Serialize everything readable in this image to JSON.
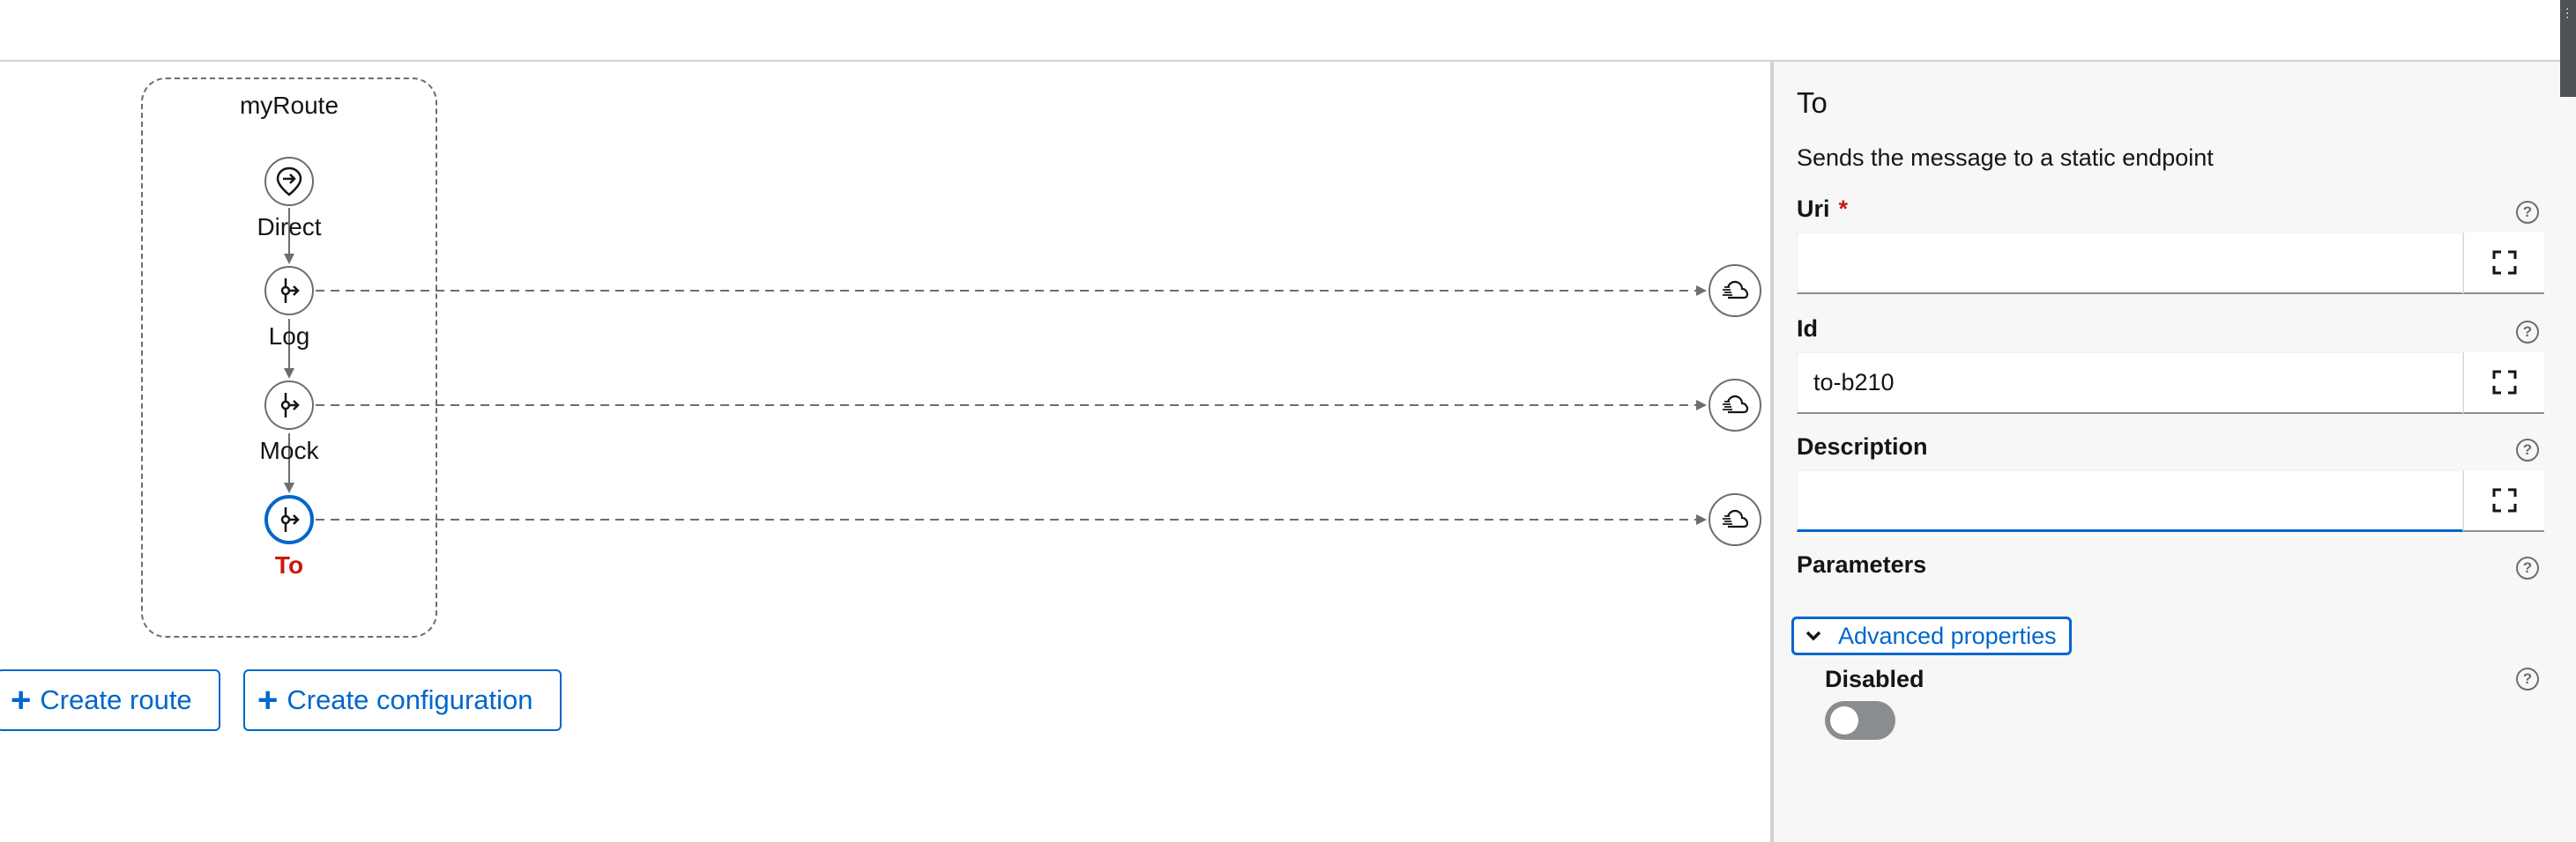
{
  "route": {
    "title": "myRoute",
    "nodes": [
      {
        "label": "Direct",
        "icon": "direct-pin-icon"
      },
      {
        "label": "Log",
        "icon": "log-processor-icon"
      },
      {
        "label": "Mock",
        "icon": "mock-processor-icon"
      },
      {
        "label": "To",
        "icon": "to-processor-icon",
        "selected": true
      }
    ],
    "endpoint_icon": "cloud-endpoint-icon"
  },
  "actions": {
    "create_route": "Create route",
    "create_configuration": "Create configuration"
  },
  "panel": {
    "title": "To",
    "description": "Sends the message to a static endpoint",
    "fields": {
      "uri": {
        "label": "Uri",
        "required_mark": "*",
        "value": ""
      },
      "id": {
        "label": "Id",
        "value": "to-b210"
      },
      "description": {
        "label": "Description",
        "value": ""
      }
    },
    "parameters_label": "Parameters",
    "advanced_label": "Advanced properties",
    "disabled": {
      "label": "Disabled",
      "value": false
    }
  },
  "colors": {
    "accent": "#0066cc",
    "required": "#c9190b",
    "selected_label": "#c9190b"
  }
}
